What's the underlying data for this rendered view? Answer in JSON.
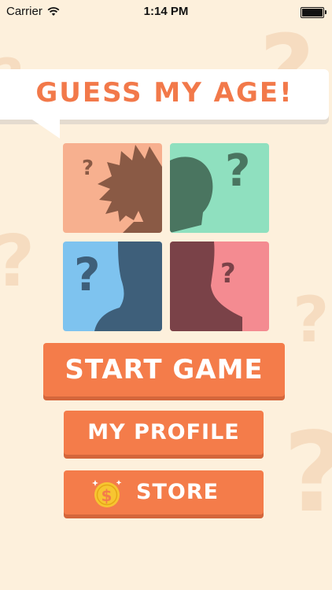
{
  "status_bar": {
    "carrier": "Carrier",
    "time": "1:14 PM",
    "battery_level": 1.0
  },
  "title": "GUESS MY AGE!",
  "tiles": [
    {
      "name": "tile-orange",
      "bg": "#f7b08f",
      "fg": "#8a5a45"
    },
    {
      "name": "tile-green",
      "bg": "#8fe0bf",
      "fg": "#4a7560"
    },
    {
      "name": "tile-blue",
      "bg": "#7ec3ef",
      "fg": "#3e5f7a"
    },
    {
      "name": "tile-pink",
      "bg": "#f48b91",
      "fg": "#7a4248"
    }
  ],
  "buttons": {
    "start": "START GAME",
    "profile": "MY PROFILE",
    "store": "STORE"
  },
  "colors": {
    "background": "#fdf0dc",
    "accent": "#f47c4a",
    "title": "#f2794a"
  }
}
